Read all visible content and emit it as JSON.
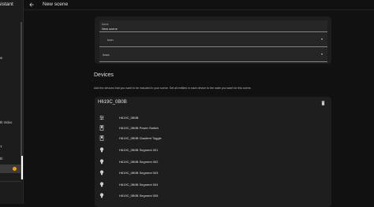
{
  "sidebar": {
    "app_fragment": "sistant",
    "fragments": [
      "w",
      "th Video",
      "T",
      "th"
    ]
  },
  "header": {
    "title": "New scene"
  },
  "scene": {
    "name_label": "Name",
    "name_value": "New scene",
    "icon_label": "Icon",
    "area_label": "Area"
  },
  "devices": {
    "title": "Devices",
    "description": "Add the devices that you want to be included in your scene. Set all entities in each device to the state you want for this scene.",
    "device": {
      "name": "H619C_0B0B",
      "entities": [
        {
          "label": "H619C_0B0B",
          "icon": "tune-icon"
        },
        {
          "label": "H619C_0B0B Power Switch",
          "icon": "switch-icon"
        },
        {
          "label": "H619C_0B0B Gradient Toggle",
          "icon": "switch-icon"
        },
        {
          "label": "H619C_0B0B Segment 001",
          "icon": "bulb-icon"
        },
        {
          "label": "H619C_0B0B Segment 002",
          "icon": "bulb-icon"
        },
        {
          "label": "H619C_0B0B Segment 003",
          "icon": "bulb-icon"
        },
        {
          "label": "H619C_0B0B Segment 004",
          "icon": "bulb-icon"
        },
        {
          "label": "H619C_0B0B Segment 005",
          "icon": "bulb-icon"
        }
      ]
    }
  },
  "colors": {
    "background": "#111111",
    "card": "#1e1e1e",
    "badge": "#f59f00"
  }
}
